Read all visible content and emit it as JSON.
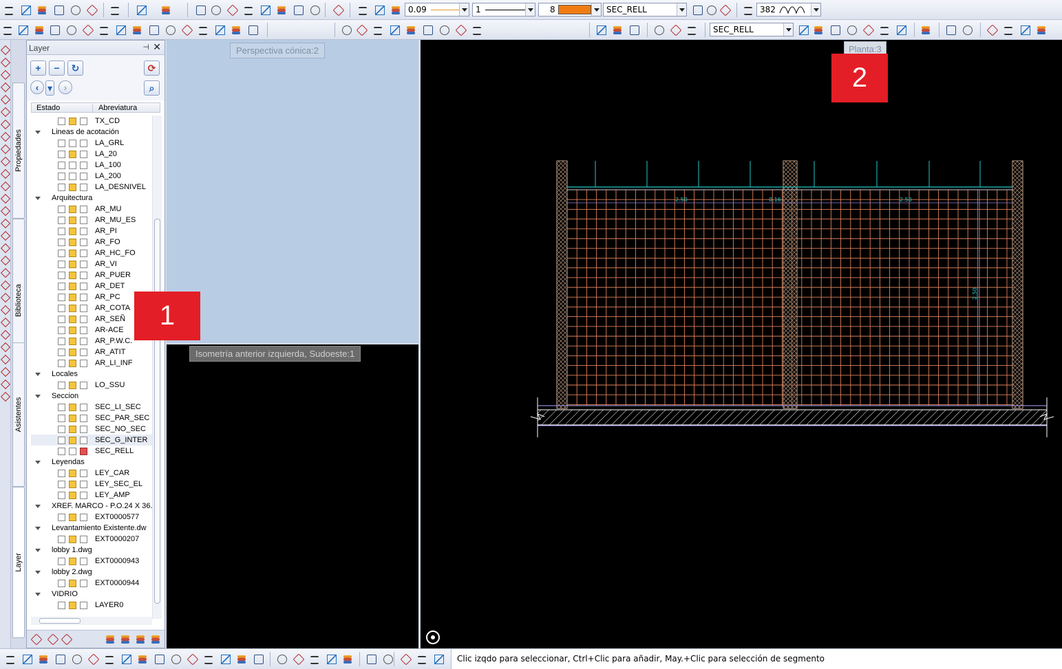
{
  "toolbar": {
    "line_weight": "0.09",
    "line_type": "1",
    "pen_color_index": "8",
    "layer_name": "SEC_RELL",
    "zoom_value": "382",
    "layer_name_2": "SEC_RELL",
    "pen_color": "#f07c12"
  },
  "left_tabs": [
    "Propiedades",
    "Biblioteca",
    "Asistentes",
    "Layer"
  ],
  "layer_panel": {
    "title": "Layer",
    "columns": {
      "estado": "Estado",
      "abreviatura": "Abreviatura"
    },
    "rows": [
      {
        "type": "item",
        "name": "TX_CD",
        "state": [
          "w",
          "y",
          "w"
        ]
      },
      {
        "type": "group",
        "name": "Lineas de acotación"
      },
      {
        "type": "item",
        "name": "LA_GRL",
        "state": [
          "w",
          "w",
          "w"
        ]
      },
      {
        "type": "item",
        "name": "LA_20",
        "state": [
          "w",
          "y",
          "w"
        ]
      },
      {
        "type": "item",
        "name": "LA_100",
        "state": [
          "w",
          "w",
          "w"
        ]
      },
      {
        "type": "item",
        "name": "LA_200",
        "state": [
          "w",
          "w",
          "w"
        ]
      },
      {
        "type": "item",
        "name": "LA_DESNIVEL",
        "state": [
          "w",
          "y",
          "w"
        ]
      },
      {
        "type": "group",
        "name": "Arquitectura"
      },
      {
        "type": "item",
        "name": "AR_MU",
        "state": [
          "w",
          "y",
          "w"
        ]
      },
      {
        "type": "item",
        "name": "AR_MU_ES",
        "state": [
          "w",
          "y",
          "w"
        ]
      },
      {
        "type": "item",
        "name": "AR_PI",
        "state": [
          "w",
          "y",
          "w"
        ]
      },
      {
        "type": "item",
        "name": "AR_FO",
        "state": [
          "w",
          "y",
          "w"
        ]
      },
      {
        "type": "item",
        "name": "AR_HC_FO",
        "state": [
          "w",
          "y",
          "w"
        ]
      },
      {
        "type": "item",
        "name": "AR_VI",
        "state": [
          "w",
          "y",
          "w"
        ]
      },
      {
        "type": "item",
        "name": "AR_PUER",
        "state": [
          "w",
          "y",
          "w"
        ]
      },
      {
        "type": "item",
        "name": "AR_DET",
        "state": [
          "w",
          "y",
          "w"
        ]
      },
      {
        "type": "item",
        "name": "AR_PC",
        "state": [
          "w",
          "y",
          "w"
        ]
      },
      {
        "type": "item",
        "name": "AR_COTA",
        "state": [
          "w",
          "y",
          "w"
        ]
      },
      {
        "type": "item",
        "name": "AR_SEÑ",
        "state": [
          "w",
          "y",
          "w"
        ]
      },
      {
        "type": "item",
        "name": "AR-ACE",
        "state": [
          "w",
          "y",
          "w"
        ]
      },
      {
        "type": "item",
        "name": "AR_P.W.C.",
        "state": [
          "w",
          "y",
          "w"
        ]
      },
      {
        "type": "item",
        "name": "AR_ATIT",
        "state": [
          "w",
          "y",
          "w"
        ]
      },
      {
        "type": "item",
        "name": "AR_LI_INF",
        "state": [
          "w",
          "y",
          "w"
        ]
      },
      {
        "type": "group",
        "name": "Locales"
      },
      {
        "type": "item",
        "name": "LO_SSU",
        "state": [
          "w",
          "y",
          "w"
        ]
      },
      {
        "type": "group",
        "name": "Seccion"
      },
      {
        "type": "item",
        "name": "SEC_LI_SEC",
        "state": [
          "w",
          "y",
          "w"
        ]
      },
      {
        "type": "item",
        "name": "SEC_PAR_SEC",
        "state": [
          "w",
          "y",
          "w"
        ]
      },
      {
        "type": "item",
        "name": "SEC_NO_SEC",
        "state": [
          "w",
          "y",
          "w"
        ]
      },
      {
        "type": "item",
        "name": "SEC_G_INTER",
        "state": [
          "w",
          "y",
          "w"
        ],
        "selected": true
      },
      {
        "type": "item",
        "name": "SEC_RELL",
        "state": [
          "w",
          "w",
          "r"
        ]
      },
      {
        "type": "group",
        "name": "Leyendas"
      },
      {
        "type": "item",
        "name": "LEY_CAR",
        "state": [
          "w",
          "y",
          "w"
        ]
      },
      {
        "type": "item",
        "name": "LEY_SEC_EL",
        "state": [
          "w",
          "y",
          "w"
        ]
      },
      {
        "type": "item",
        "name": "LEY_AMP",
        "state": [
          "w",
          "y",
          "w"
        ]
      },
      {
        "type": "group",
        "name": "XREF. MARCO - P.O.24 X 36."
      },
      {
        "type": "item",
        "name": "EXT0000577",
        "state": [
          "w",
          "y",
          "w"
        ]
      },
      {
        "type": "group",
        "name": "Levantamiento Existente.dw"
      },
      {
        "type": "item",
        "name": "EXT0000207",
        "state": [
          "w",
          "y",
          "w"
        ]
      },
      {
        "type": "group",
        "name": "lobby 1.dwg"
      },
      {
        "type": "item",
        "name": "EXT0000943",
        "state": [
          "w",
          "y",
          "w"
        ]
      },
      {
        "type": "group",
        "name": "lobby 2.dwg"
      },
      {
        "type": "item",
        "name": "EXT0000944",
        "state": [
          "w",
          "y",
          "w"
        ]
      },
      {
        "type": "group",
        "name": "VIDRIO"
      },
      {
        "type": "item",
        "name": "LAYER0",
        "state": [
          "w",
          "y",
          "w"
        ]
      }
    ]
  },
  "viewports": {
    "perspective_label": "Perspectiva cónica:2",
    "isometric_label": "Isometría anterior izquierda, Sudoeste:1",
    "plan_label": "Planta:3"
  },
  "annotations": {
    "tag1": "1",
    "tag2": "2"
  },
  "drawing": {
    "dim_left": "2.50",
    "dim_mid": "0.16",
    "dim_right": "2.50",
    "dim_vertical": "2.50"
  },
  "status_bar": {
    "message": "Clic izqdo para seleccionar, Ctrl+Clic para añadir, May.+Clic para selección de segmento"
  }
}
